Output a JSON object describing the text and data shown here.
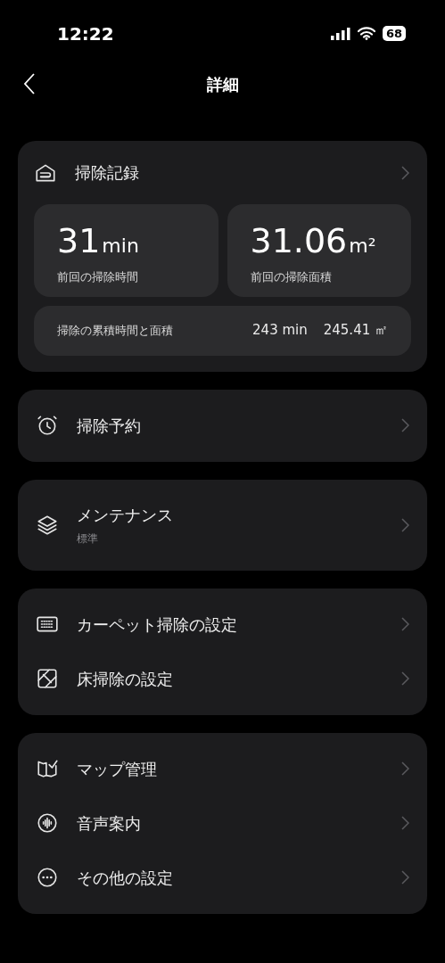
{
  "status_bar": {
    "time": "12:22",
    "battery": "68"
  },
  "header": {
    "title": "詳細"
  },
  "record": {
    "title": "掃除記録",
    "kind": "record",
    "stats": [
      {
        "value": "31",
        "unit": "min",
        "label": "前回の掃除時間"
      },
      {
        "value": "31.06",
        "unit": "m²",
        "label": "前回の掃除面積"
      }
    ],
    "total": {
      "label": "掃除の累積時間と面積",
      "time": "243 min",
      "area": "245.41 ㎡"
    }
  },
  "groups": [
    {
      "items": [
        {
          "kind": "alarm",
          "label": "掃除予約"
        }
      ]
    },
    {
      "items": [
        {
          "kind": "layers",
          "label": "メンテナンス",
          "subtitle": "標準"
        }
      ]
    },
    {
      "items": [
        {
          "kind": "carpet",
          "label": "カーペット掃除の設定"
        },
        {
          "kind": "floor",
          "label": "床掃除の設定"
        }
      ]
    },
    {
      "items": [
        {
          "kind": "map",
          "label": "マップ管理"
        },
        {
          "kind": "voice",
          "label": "音声案内"
        },
        {
          "kind": "more",
          "label": "その他の設定"
        }
      ]
    }
  ]
}
